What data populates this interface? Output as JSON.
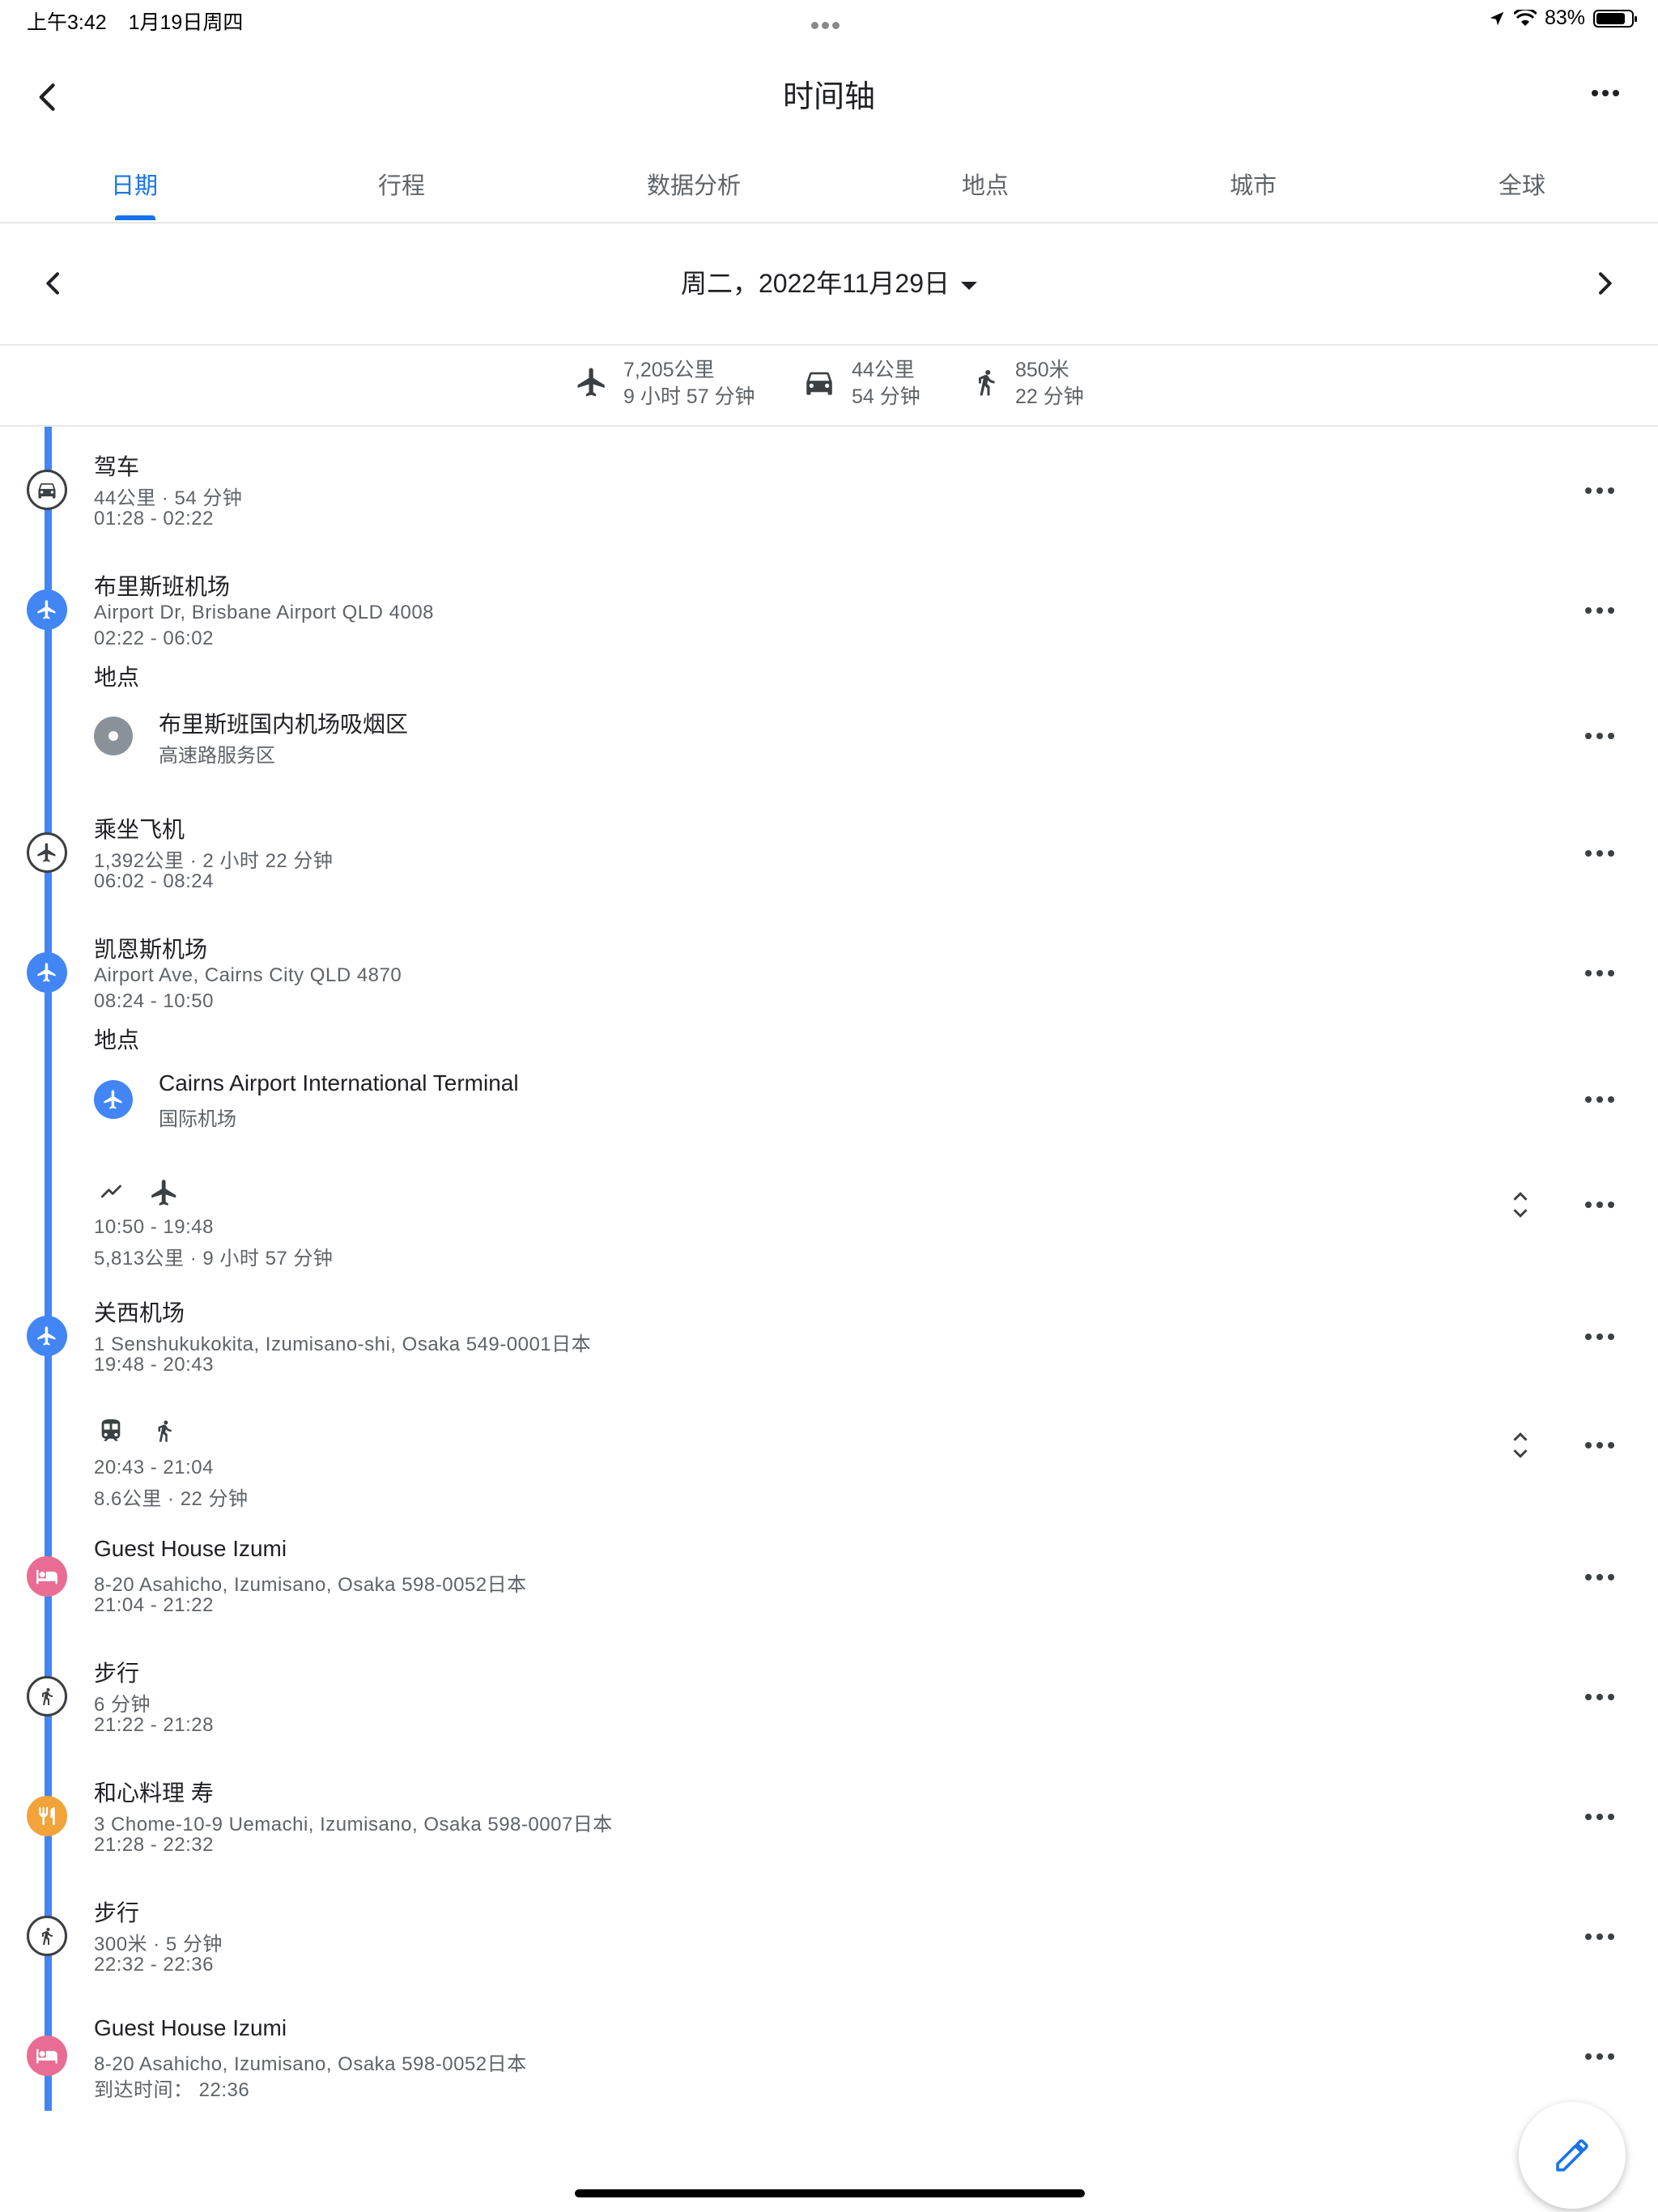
{
  "status": {
    "time": "上午3:42",
    "date": "1月19日周四",
    "battery": "83%",
    "battery_level": 0.83
  },
  "header": {
    "title": "时间轴"
  },
  "tabs": [
    "日期",
    "行程",
    "数据分析",
    "地点",
    "城市",
    "全球"
  ],
  "active_tab": 0,
  "date_nav": {
    "date": "周二，2022年11月29日"
  },
  "summary": {
    "flight": {
      "distance": "7,205公里",
      "duration": "9 小时 57 分钟"
    },
    "drive": {
      "distance": "44公里",
      "duration": "54 分钟"
    },
    "walk": {
      "distance": "850米",
      "duration": "22 分钟"
    }
  },
  "entries": [
    {
      "title": "驾车",
      "line1": "44公里 · 54 分钟",
      "line2": "01:28 - 02:22"
    },
    {
      "title": "布里斯班机场",
      "line1": "Airport Dr, Brisbane Airport QLD 4008",
      "line2": "02:22 - 06:02",
      "places_label": "地点",
      "place": {
        "name": "布里斯班国内机场吸烟区",
        "type": "高速路服务区"
      }
    },
    {
      "title": "乘坐飞机",
      "line1": "1,392公里 · 2 小时 22 分钟",
      "line2": "06:02 - 08:24"
    },
    {
      "title": "凯恩斯机场",
      "line1": "Airport Ave, Cairns City QLD 4870",
      "line2": "08:24 - 10:50",
      "places_label": "地点",
      "place": {
        "name": "Cairns Airport International Terminal",
        "type": "国际机场"
      }
    },
    {
      "line1": "10:50 - 19:48",
      "line2": "5,813公里 · 9 小时 57 分钟"
    },
    {
      "title": "关西机场",
      "line1": "1 Senshukukokita, Izumisano-shi, Osaka 549-0001日本",
      "line2": "19:48 - 20:43"
    },
    {
      "line1": "20:43 - 21:04",
      "line2": "8.6公里 · 22 分钟"
    },
    {
      "title": "Guest House Izumi",
      "line1": "8-20 Asahicho, Izumisano, Osaka 598-0052日本",
      "line2": "21:04 - 21:22"
    },
    {
      "title": "步行",
      "line1": "6 分钟",
      "line2": "21:22 - 21:28"
    },
    {
      "title": "和心料理 寿",
      "line1": "3 Chome-10-9 Uemachi, Izumisano, Osaka 598-0007日本",
      "line2": "21:28 - 22:32"
    },
    {
      "title": "步行",
      "line1": "300米 · 5 分钟",
      "line2": "22:32 - 22:36"
    },
    {
      "title": "Guest House Izumi",
      "line1": "8-20 Asahicho, Izumisano, Osaka 598-0052日本",
      "line2": "到达时间： 22:36"
    }
  ],
  "icons": {
    "back": "back-arrow-icon",
    "more": "more-horizontal-icon",
    "car": "car-icon",
    "airplane": "airplane-icon",
    "walk": "walk-icon",
    "train": "train-icon",
    "hotel": "hotel-icon",
    "restaurant": "restaurant-icon",
    "edit": "pencil-icon"
  },
  "colors": {
    "accent": "#1a73e8",
    "timeline": "#4285f4",
    "hotel": "#e96d93",
    "restaurant": "#f2a33a"
  }
}
